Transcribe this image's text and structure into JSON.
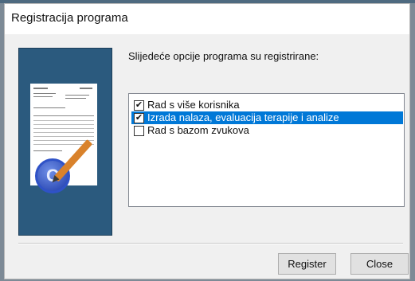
{
  "window": {
    "title": "Registracija programa"
  },
  "intro_text": "Slijedeće opcije programa su registrirane:",
  "options": [
    {
      "label": "Rad s više korisnika",
      "checked": true,
      "selected": false
    },
    {
      "label": "Izrada nalaza, evaluacija terapije i analize",
      "checked": true,
      "selected": true
    },
    {
      "label": "Rad s bazom zvukova",
      "checked": false,
      "selected": false
    }
  ],
  "buttons": {
    "register": "Register",
    "close": "Close"
  },
  "colors": {
    "selection": "#0078d7",
    "side_panel": "#2b5a7e"
  },
  "icons": [
    "certificate-seal-icon",
    "pen-icon",
    "document-icon",
    "checkmark-icon"
  ]
}
